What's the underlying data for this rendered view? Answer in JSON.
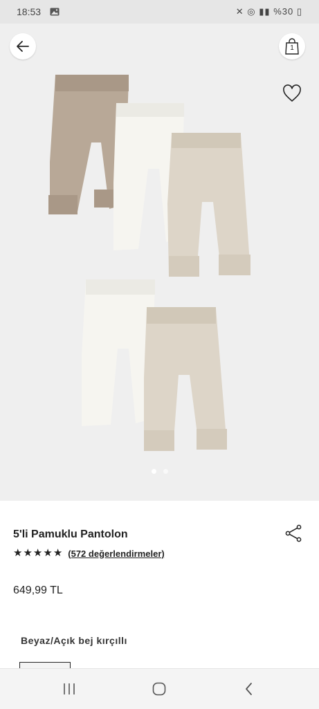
{
  "status_bar": {
    "time": "18:53",
    "battery": "%30"
  },
  "header": {
    "bag_count": "1"
  },
  "gallery": {
    "slides": 2,
    "active_slide": 1
  },
  "product": {
    "title": "5'li Pamuklu Pantolon",
    "rating": 5,
    "reviews_link": "(572 değerlendirmeler)",
    "price": "649,99 TL",
    "color_name": "Beyaz/Açık bej kırçıllı"
  },
  "icons": [
    "back-arrow-icon",
    "shopping-bag-icon",
    "heart-icon",
    "share-icon",
    "star-icon",
    "recent-apps-icon",
    "home-icon",
    "back-chevron-icon"
  ]
}
